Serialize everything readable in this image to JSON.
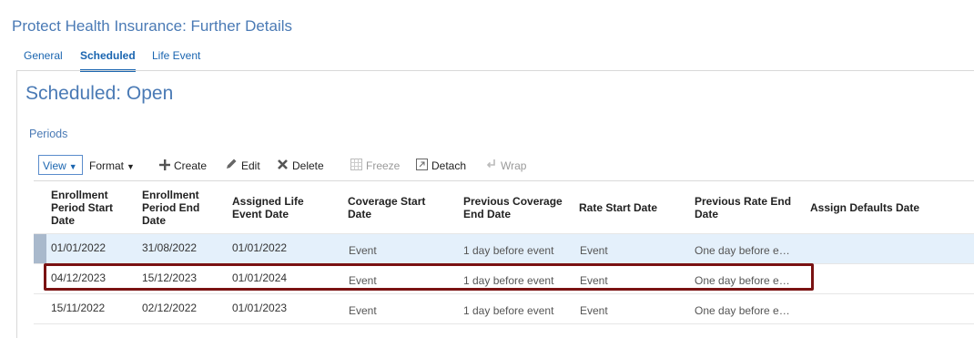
{
  "page": {
    "title": "Protect Health Insurance: Further Details"
  },
  "tabs": [
    {
      "label": "General",
      "active": false
    },
    {
      "label": "Scheduled",
      "active": true
    },
    {
      "label": "Life Event",
      "active": false
    }
  ],
  "section": {
    "title": "Scheduled: Open",
    "subheading": "Periods"
  },
  "toolbar": {
    "view_label": "View",
    "format_label": "Format",
    "create_label": "Create",
    "edit_label": "Edit",
    "delete_label": "Delete",
    "freeze_label": "Freeze",
    "detach_label": "Detach",
    "wrap_label": "Wrap"
  },
  "table": {
    "columns": [
      "Enrollment Period Start Date",
      "Enrollment Period End Date",
      "Assigned Life Event Date",
      "Coverage Start Date",
      "Previous Coverage End Date",
      "Rate Start Date",
      "Previous Rate End Date",
      "Assign Defaults Date"
    ],
    "rows": [
      {
        "start": "01/01/2022",
        "end": "31/08/2022",
        "life_event": "01/01/2022",
        "coverage_start": "Event",
        "prev_coverage_end": "1 day before event",
        "rate_start": "Event",
        "prev_rate_end": "One day before e…",
        "assign_defaults": ""
      },
      {
        "start": "04/12/2023",
        "end": "15/12/2023",
        "life_event": "01/01/2024",
        "coverage_start": "Event",
        "prev_coverage_end": "1 day before event",
        "rate_start": "Event",
        "prev_rate_end": "One day before e…",
        "assign_defaults": ""
      },
      {
        "start": "15/11/2022",
        "end": "02/12/2022",
        "life_event": "01/01/2023",
        "coverage_start": "Event",
        "prev_coverage_end": "1 day before event",
        "rate_start": "Event",
        "prev_rate_end": "One day before e…",
        "assign_defaults": ""
      }
    ]
  },
  "colors": {
    "link": "#1a65b0",
    "title": "#4a7ab5",
    "selected_row": "#e4f0fb",
    "highlight_border": "#7a1212"
  }
}
